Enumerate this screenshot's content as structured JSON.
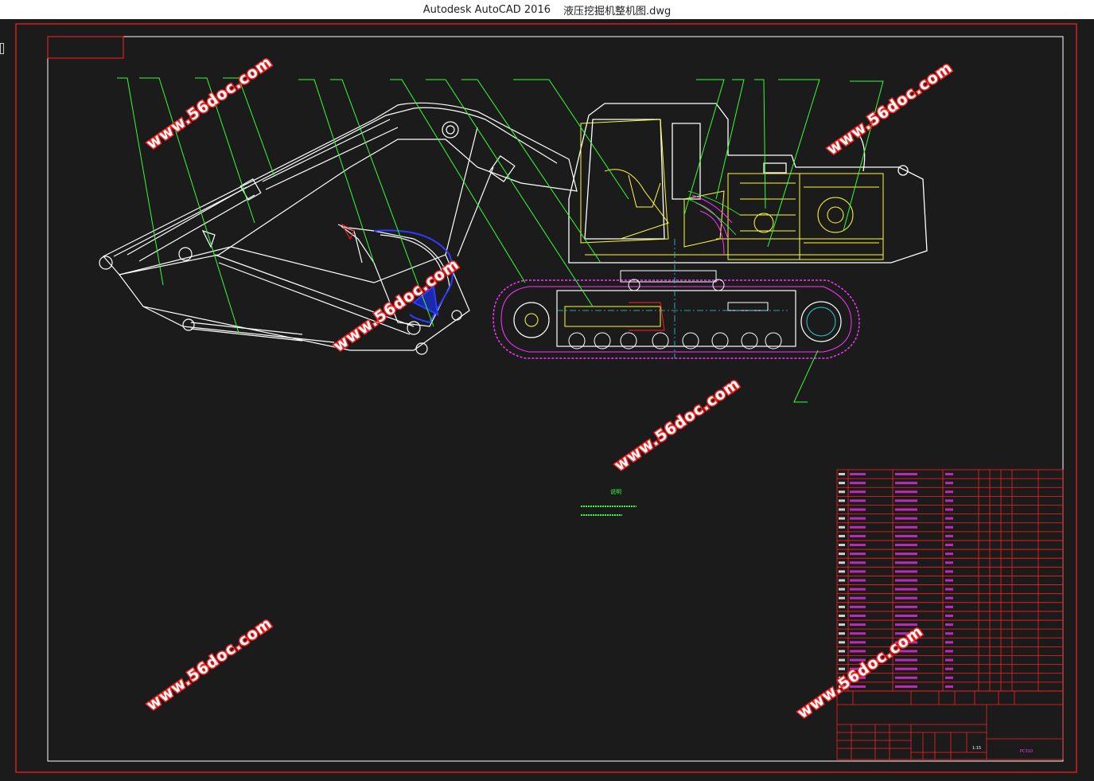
{
  "window": {
    "app_title": "Autodesk AutoCAD 2016",
    "document_title": "液压挖掘机整机图.dwg"
  },
  "drawing": {
    "notes_heading": "说明",
    "watermark_text": "www.56doc.com",
    "title_block_scale": "1:15",
    "title_block_model": "PC310",
    "colors": {
      "border": "#ff2020",
      "frame": "#ffffff",
      "leader": "#33ff33",
      "cab": "#ffff33",
      "track": "#ff33ff",
      "bucket_highlight": "#2a3cff",
      "centerline": "#33cccc"
    }
  }
}
